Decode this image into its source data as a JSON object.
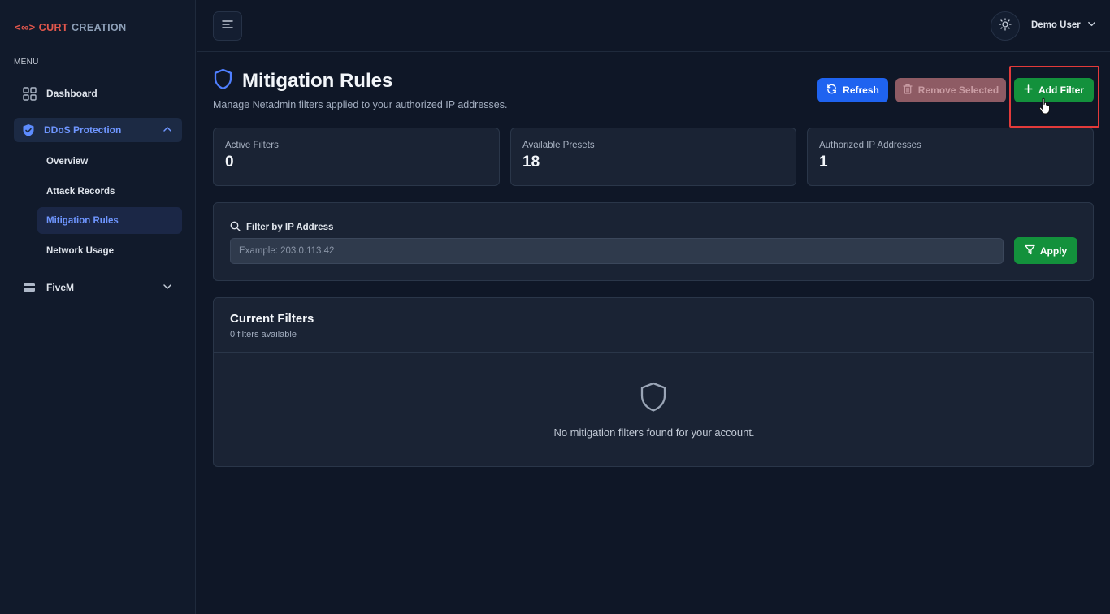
{
  "brand": {
    "mark": "<∞>",
    "word1": "CURT",
    "word2": "CREATION"
  },
  "sidebar": {
    "menu_label": "MENU",
    "dashboard": "Dashboard",
    "ddos": "DDoS Protection",
    "sub_items": [
      "Overview",
      "Attack Records",
      "Mitigation Rules",
      "Network Usage"
    ],
    "fivem": "FiveM"
  },
  "header": {
    "user": "Demo User"
  },
  "page": {
    "title": "Mitigation Rules",
    "subtitle": "Manage Netadmin filters applied to your authorized IP addresses.",
    "refresh": "Refresh",
    "remove_selected": "Remove Selected",
    "add_filter": "Add Filter"
  },
  "stats": [
    {
      "label": "Active Filters",
      "value": "0"
    },
    {
      "label": "Available Presets",
      "value": "18"
    },
    {
      "label": "Authorized IP Addresses",
      "value": "1"
    }
  ],
  "filter": {
    "label": "Filter by IP Address",
    "placeholder": "Example: 203.0.113.42",
    "value": "",
    "apply": "Apply"
  },
  "current_filters": {
    "title": "Current Filters",
    "count": "0 filters available",
    "empty": "No mitigation filters found for your account."
  },
  "colors": {
    "accent_blue": "#1f63f0",
    "success_green": "#13913c",
    "danger_muted": "#8e5b64",
    "highlight_red": "#e23a3a"
  }
}
